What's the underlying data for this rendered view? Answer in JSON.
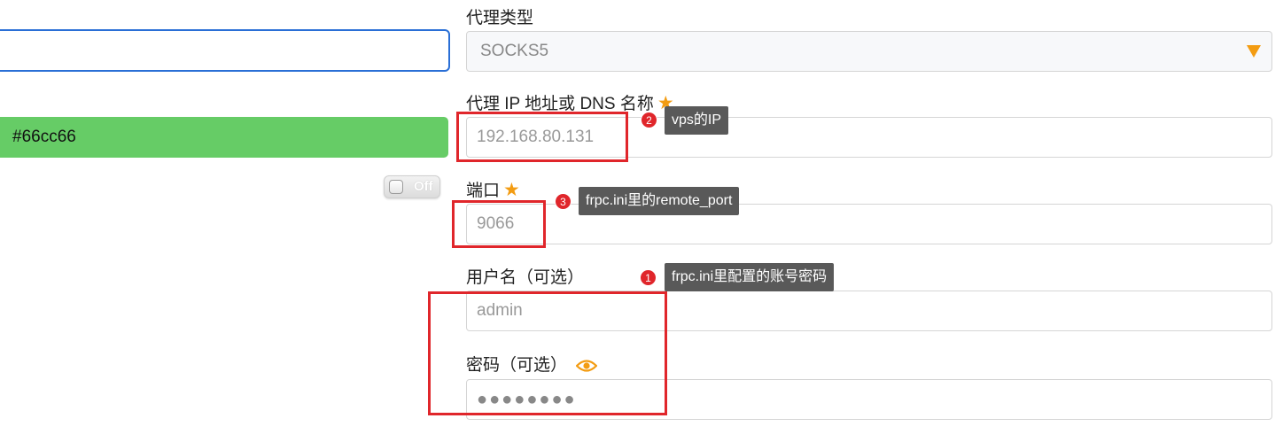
{
  "left": {
    "name_input_value": "",
    "color_value": "#66cc66",
    "color_bg": "#66cc66",
    "toggle_label": "Off"
  },
  "proxy": {
    "type_label": "代理类型",
    "type_value": "SOCKS5",
    "host_label": "代理 IP 地址或 DNS 名称",
    "host_value": "192.168.80.131",
    "port_label": "端口",
    "port_value": "9066",
    "username_label": "用户名（可选）",
    "username_value": "admin",
    "password_label": "密码（可选）",
    "password_value": "●●●●●●●●"
  },
  "annotations": [
    {
      "number": "2",
      "text": "vps的IP"
    },
    {
      "number": "3",
      "text": "frpc.ini里的remote_port"
    },
    {
      "number": "1",
      "text": "frpc.ini里配置的账号密码"
    }
  ],
  "icons": {
    "required": "star-icon",
    "dropdown": "triangle-down-icon",
    "reveal_password": "eye-icon"
  },
  "colors": {
    "accent": "#f39c12",
    "highlight": "#e0262b",
    "focus_border": "#2a6fd6"
  }
}
